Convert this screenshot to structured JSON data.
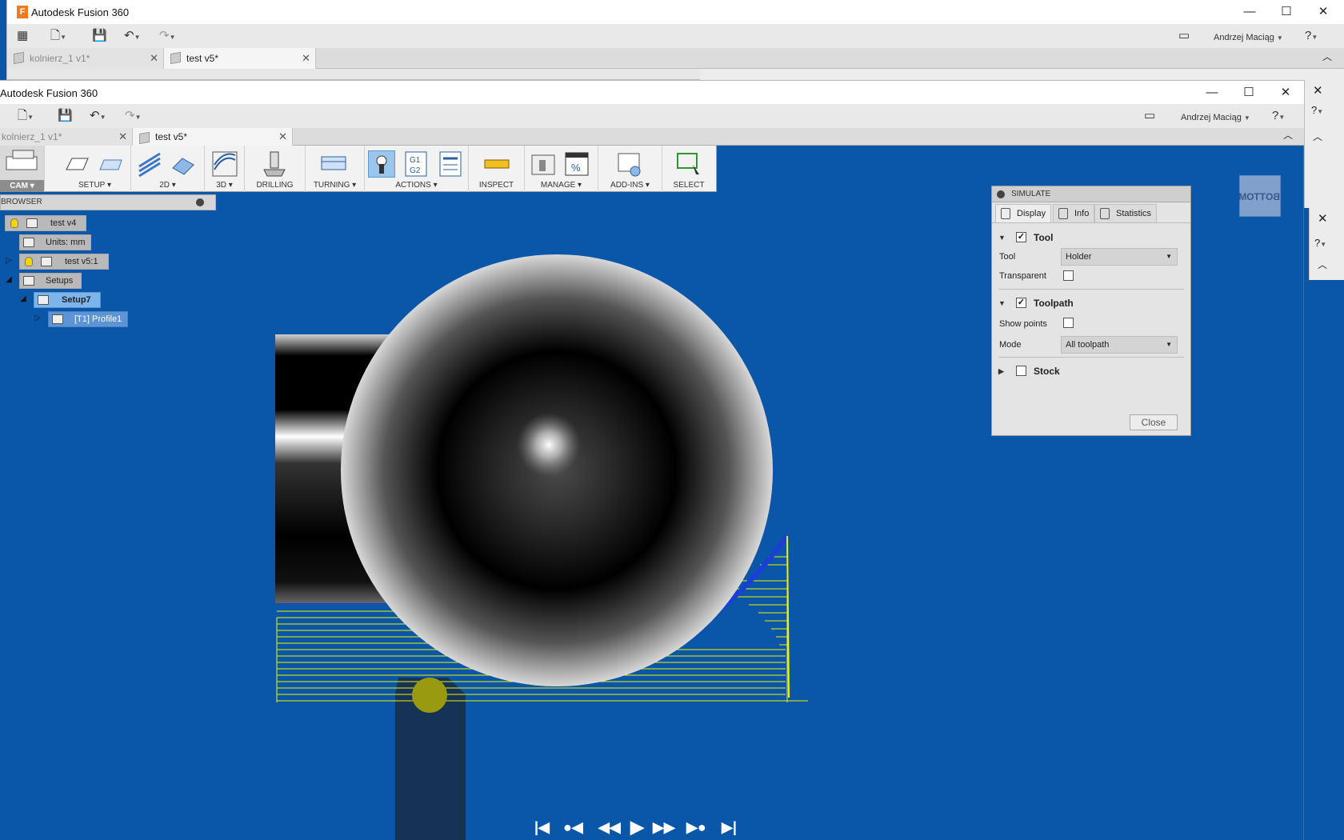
{
  "back_window": {
    "title": "Autodesk Fusion 360",
    "user": "Andrzej Maciąg",
    "tabs": [
      {
        "label": "kolnierz_1 v1*",
        "active": false
      },
      {
        "label": "test v5*",
        "active": true
      }
    ]
  },
  "front_window": {
    "title": "Autodesk Fusion 360",
    "user": "Andrzej Maciąg",
    "tabs": [
      {
        "label": "kolnierz_1 v1*",
        "active": false
      },
      {
        "label": "test v5*",
        "active": true
      }
    ]
  },
  "ribbon": {
    "workspace": "CAM",
    "groups": [
      "SETUP",
      "2D",
      "3D",
      "DRILLING",
      "TURNING",
      "ACTIONS",
      "INSPECT",
      "MANAGE",
      "ADD-INS",
      "SELECT"
    ]
  },
  "browser": {
    "title": "BROWSER",
    "nodes": [
      "test v4",
      "Units: mm",
      "test v5:1",
      "Setups",
      "Setup7",
      "[T1] Profile1"
    ]
  },
  "simulate": {
    "title": "SIMULATE",
    "tabs": [
      "Display",
      "Info",
      "Statistics"
    ],
    "tool_section": {
      "label": "Tool",
      "checked": true
    },
    "tool_label": "Tool",
    "tool_value": "Holder",
    "transparent_label": "Transparent",
    "transparent_checked": false,
    "toolpath_section": {
      "label": "Toolpath",
      "checked": true
    },
    "show_points_label": "Show points",
    "show_points_checked": false,
    "mode_label": "Mode",
    "mode_value": "All toolpath",
    "stock_section": {
      "label": "Stock",
      "checked": false
    },
    "close_label": "Close"
  },
  "viewcube": {
    "face": "BOTTOM"
  },
  "colors": {
    "viewport_bg": "#0a56a8",
    "toolpath": "#f0f000",
    "tool_tip": "#9a9a10",
    "holder": "#163355"
  }
}
